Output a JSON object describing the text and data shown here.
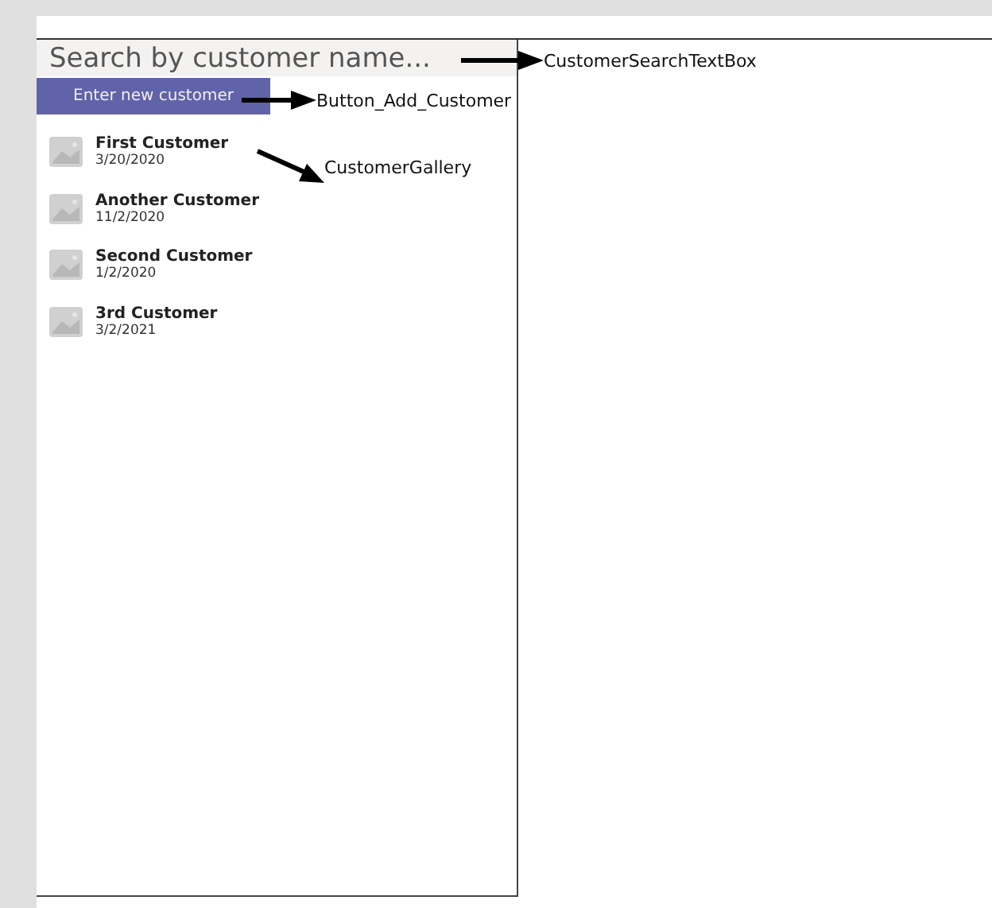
{
  "search": {
    "placeholder": "Search by customer name..."
  },
  "add_button": {
    "label": "Enter new customer"
  },
  "customers": [
    {
      "name": "First Customer",
      "date": "3/20/2020"
    },
    {
      "name": "Another Customer",
      "date": "11/2/2020"
    },
    {
      "name": "Second Customer",
      "date": "1/2/2020"
    },
    {
      "name": "3rd Customer",
      "date": "3/2/2021"
    }
  ],
  "annotations": [
    {
      "label": "CustomerSearchTextBox"
    },
    {
      "label": "Button_Add_Customer"
    },
    {
      "label": "CustomerGallery"
    }
  ]
}
